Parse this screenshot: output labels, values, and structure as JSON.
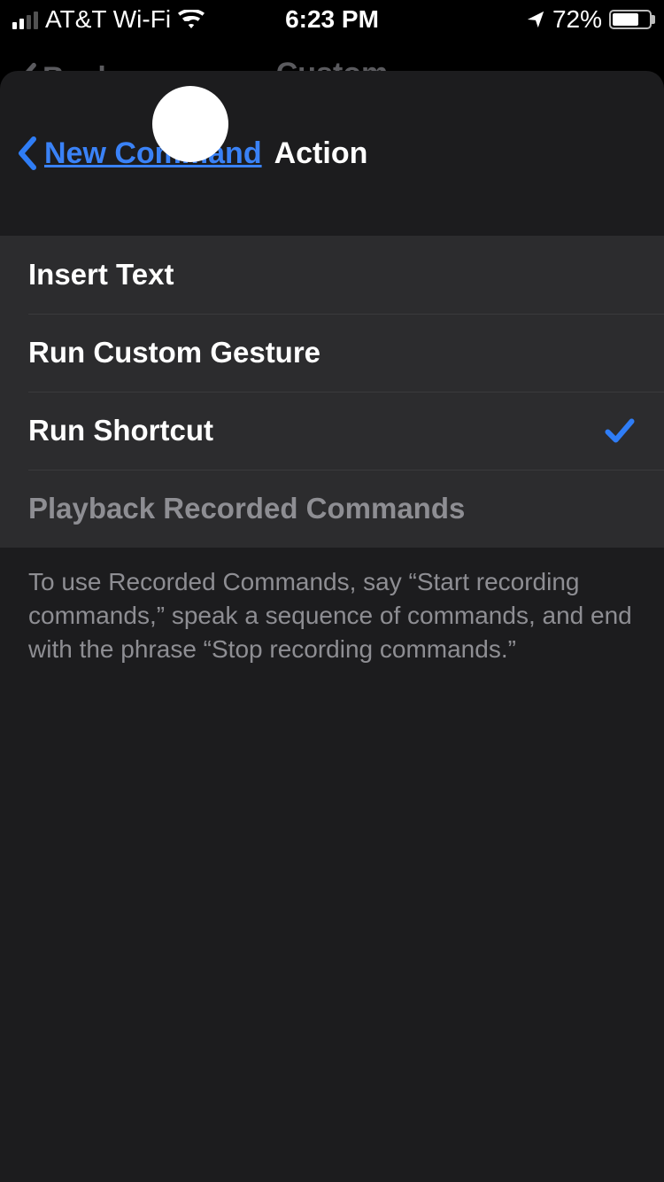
{
  "status": {
    "carrier": "AT&T Wi-Fi",
    "time": "6:23 PM",
    "battery_pct": "72%",
    "battery_fill_pct": 72
  },
  "bg_nav": {
    "back_label": "Back",
    "title": "Custom"
  },
  "sheet": {
    "back_label": "New Command",
    "title": "Action"
  },
  "actions": [
    {
      "label": "Insert Text",
      "selected": false,
      "enabled": true
    },
    {
      "label": "Run Custom Gesture",
      "selected": false,
      "enabled": true
    },
    {
      "label": "Run Shortcut",
      "selected": true,
      "enabled": true
    },
    {
      "label": "Playback Recorded Commands",
      "selected": false,
      "enabled": false
    }
  ],
  "footer": "To use Recorded Commands, say “Start recording commands,” speak a sequence of commands, and end with the phrase “Stop recording commands.”"
}
